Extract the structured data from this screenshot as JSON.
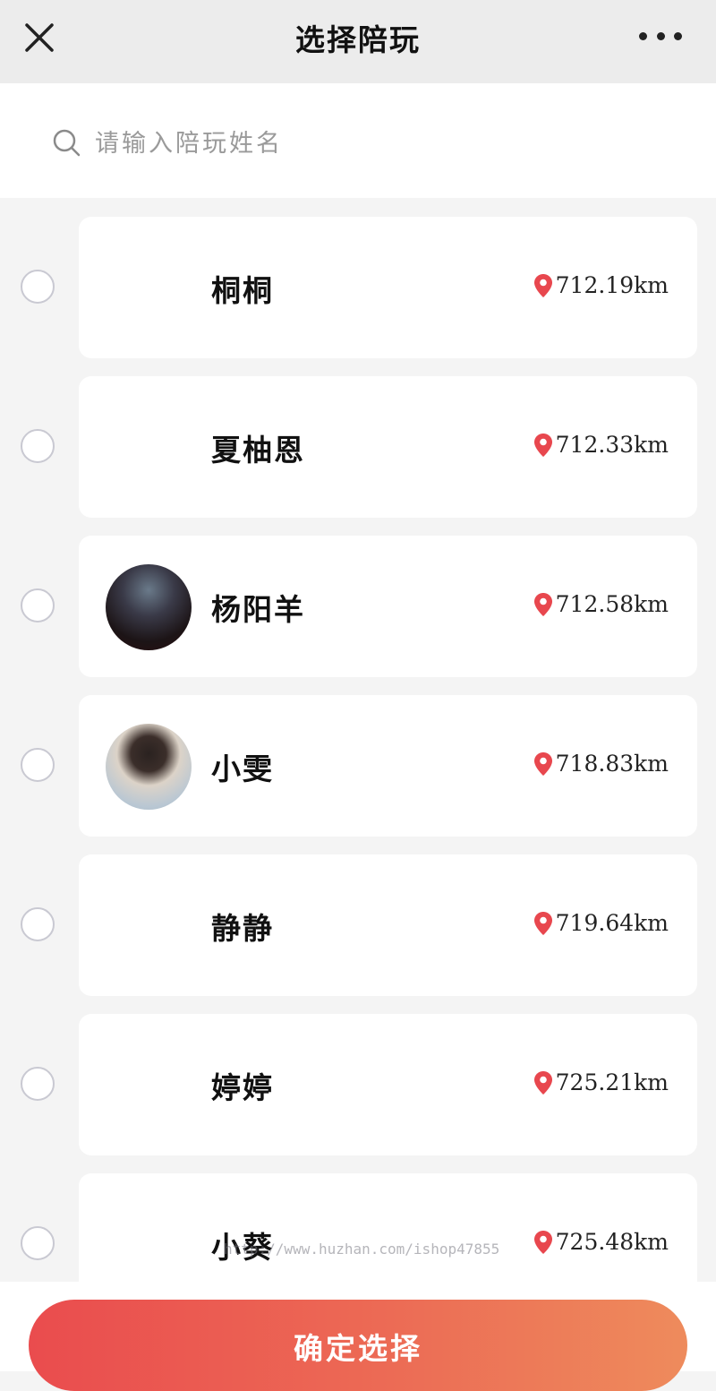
{
  "header": {
    "title": "选择陪玩",
    "close_icon": "close-icon",
    "more_icon": "more-horizontal-icon"
  },
  "search": {
    "placeholder": "请输入陪玩姓名",
    "value": "",
    "icon": "search-icon"
  },
  "list": {
    "items": [
      {
        "name": "桐桐",
        "distance": "712.19km",
        "has_avatar": false,
        "selected": false
      },
      {
        "name": "夏柚恩",
        "distance": "712.33km",
        "has_avatar": false,
        "selected": false
      },
      {
        "name": "杨阳羊",
        "distance": "712.58km",
        "has_avatar": true,
        "selected": false
      },
      {
        "name": "小雯",
        "distance": "718.83km",
        "has_avatar": true,
        "selected": false
      },
      {
        "name": "静静",
        "distance": "719.64km",
        "has_avatar": false,
        "selected": false
      },
      {
        "name": "婷婷",
        "distance": "725.21km",
        "has_avatar": false,
        "selected": false
      },
      {
        "name": "小葵",
        "distance": "725.48km",
        "has_avatar": false,
        "selected": false
      }
    ]
  },
  "watermark": "http://www.huzhan.com/ishop47855",
  "footer": {
    "confirm_label": "确定选择"
  },
  "colors": {
    "location_pin": "#e8474e",
    "button_gradient_start": "#ea4c4e",
    "button_gradient_end": "#ee8b5c",
    "radio_border": "#c9c9d2"
  }
}
